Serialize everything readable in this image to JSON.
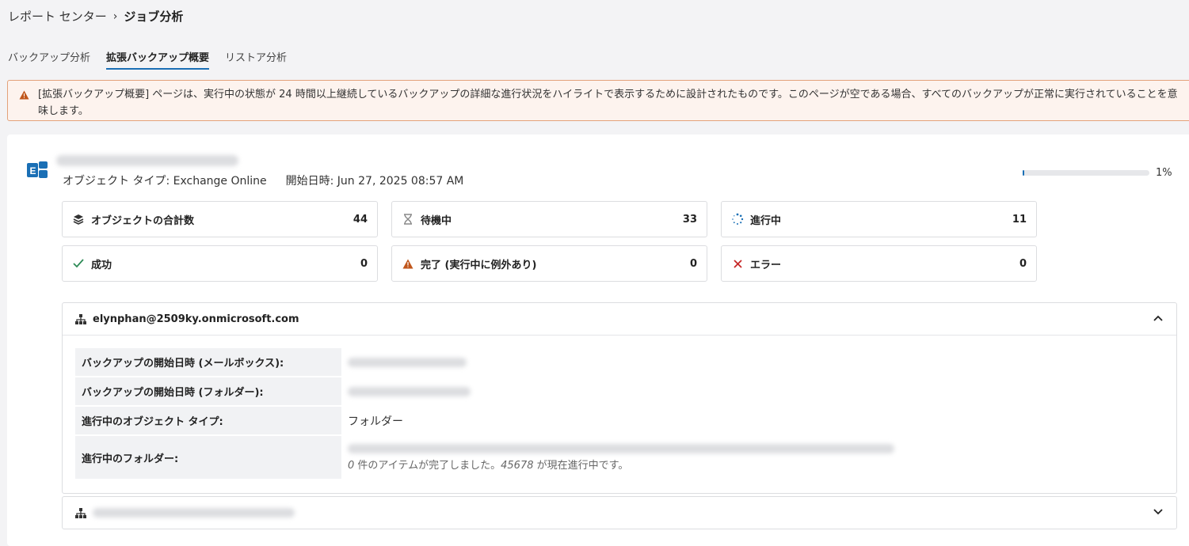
{
  "breadcrumb": {
    "parent": "レポート センター",
    "current": "ジョブ分析"
  },
  "tabs": [
    {
      "label": "バックアップ分析",
      "active": false
    },
    {
      "label": "拡張バックアップ概要",
      "active": true
    },
    {
      "label": "リストア分析",
      "active": false
    }
  ],
  "alert": {
    "text": "[拡張バックアップ概要] ページは、実行中の状態が 24 時間以上継続しているバックアップの詳細な進行状況をハイライトで表示するために設計されたものです。このページが空である場合、すべてのバックアップが正常に実行されていることを意味します。",
    "color": "#c0561b"
  },
  "job": {
    "object_type": "オブジェクト タイプ: Exchange Online",
    "start": "開始日時: Jun 27, 2025 08:57 AM",
    "progress_label": "1%",
    "progress_fraction": 0.01,
    "icon": "exchange-icon"
  },
  "stats": {
    "total": {
      "label": "オブジェクトの合計数",
      "value": "44",
      "icon": "layers-icon"
    },
    "waiting": {
      "label": "待機中",
      "value": "33",
      "icon": "hourglass-icon"
    },
    "in_progress": {
      "label": "進行中",
      "value": "11",
      "icon": "spinner-icon"
    },
    "success": {
      "label": "成功",
      "value": "0",
      "icon": "check-icon",
      "color": "#2e8b57"
    },
    "warning": {
      "label": "完了 (実行中に例外あり)",
      "value": "0",
      "icon": "warning-icon",
      "color": "#c0561b"
    },
    "error": {
      "label": "エラー",
      "value": "0",
      "icon": "close-icon",
      "color": "#c62828"
    }
  },
  "panel1": {
    "title": "elynphan@2509ky.onmicrosoft.com",
    "rows": {
      "mailbox_start": "バックアップの開始日時 (メールボックス):",
      "folder_start": "バックアップの開始日時 (フォルダー):",
      "object_type_key": "進行中のオブジェクト タイプ:",
      "object_type_val": "フォルダー",
      "folder_key": "進行中のフォルダー:",
      "note_prefix": "0",
      "note_mid": " 件のアイテムが完了しました。",
      "note_num": "45678",
      "note_suffix": " が現在進行中です。"
    }
  },
  "accent": "#1a6fb5"
}
